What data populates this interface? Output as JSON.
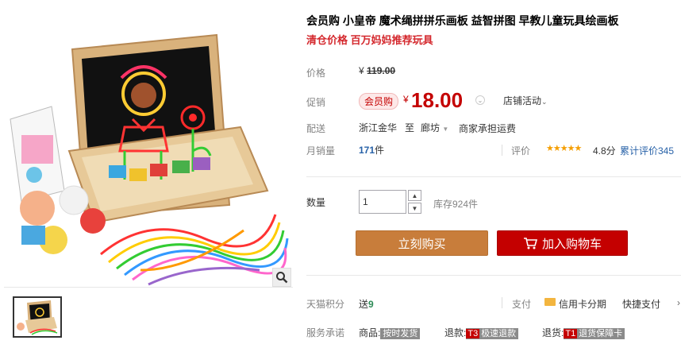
{
  "product": {
    "title": "会员购 小皇帝 魔术绳拼拼乐画板 益智拼图 早教儿童玩具绘画板",
    "subtitle": "清仓价格 百万妈妈推荐玩具"
  },
  "price": {
    "label": "价格",
    "currency": "¥",
    "original": "119.00"
  },
  "promo": {
    "label": "促销",
    "tag": "会员购",
    "currency": "¥",
    "amount": "18.00",
    "shop_activity": "店铺活动"
  },
  "shipping": {
    "label": "配送",
    "from": "浙江金华",
    "to_word": "至",
    "to": "廊坊",
    "fee": "商家承担运费"
  },
  "sales": {
    "label": "月销量",
    "count": "171",
    "unit": "件",
    "rating_label": "评价",
    "stars": "★★★★★",
    "score": "4.8分",
    "reviews": "累计评价345"
  },
  "quantity": {
    "label": "数量",
    "value": "1",
    "stock": "库存924件"
  },
  "actions": {
    "buy": "立刻购买",
    "cart": "加入购物车"
  },
  "points": {
    "label": "天猫积分",
    "prefix": "送",
    "value": "9"
  },
  "payment": {
    "label": "支付",
    "credit": "信用卡分期",
    "fast": "快捷支付",
    "more": "›"
  },
  "service": {
    "label": "服务承诺",
    "goods_label": "商品:",
    "goods_tag": "按时发货",
    "refund_label": "退款:",
    "refund_pre": "T3",
    "refund_tag": "极速退款",
    "return_label": "退货:",
    "return_pre": "T1",
    "return_tag": "退货保障卡"
  },
  "icons": {
    "zoom": "magnifier-icon",
    "cart": "cart-icon",
    "card": "credit-card-icon"
  },
  "colors": {
    "price_red": "#c40000",
    "buy_button": "#c87d3b",
    "cart_button": "#c40000",
    "link_blue": "#2862a8"
  }
}
